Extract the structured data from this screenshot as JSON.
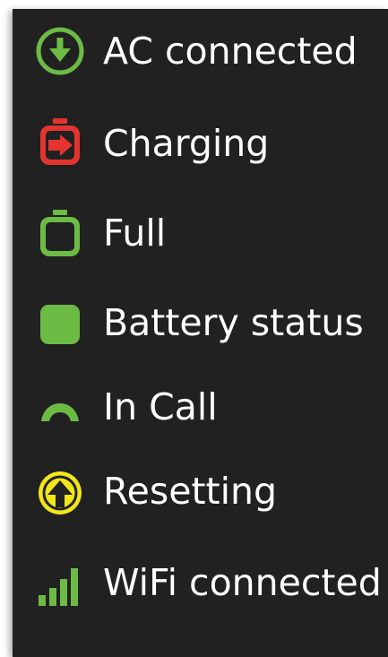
{
  "legend": {
    "items": [
      {
        "label": "AC connected",
        "icon": "ac-connected-icon",
        "color": "#6cbb45"
      },
      {
        "label": "Charging",
        "icon": "charging-battery-icon",
        "color": "#e3342f"
      },
      {
        "label": "Full",
        "icon": "full-battery-icon",
        "color": "#6cbb45"
      },
      {
        "label": "Battery status",
        "icon": "battery-status-square-icon",
        "color": "#6cbb45"
      },
      {
        "label": "In Call",
        "icon": "phone-handset-icon",
        "color": "#6cbb45"
      },
      {
        "label": "Resetting",
        "icon": "reset-arrow-icon",
        "color": "#f1e61a"
      },
      {
        "label": "WiFi connected",
        "icon": "wifi-signal-bars-icon",
        "color": "#6cbb45"
      }
    ]
  }
}
